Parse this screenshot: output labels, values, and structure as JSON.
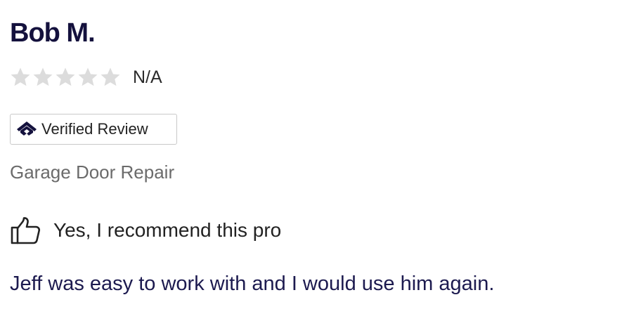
{
  "review": {
    "reviewer_name": "Bob M.",
    "rating": {
      "stars_filled": 0,
      "stars_total": 5,
      "text": "N/A",
      "star_color": "#dcdcdc"
    },
    "verified_badge": {
      "icon": "house-icon",
      "label": "Verified Review"
    },
    "service": "Garage Door Repair",
    "recommendation": {
      "icon": "thumbs-up-icon",
      "text": "Yes, I recommend this pro"
    },
    "body": "Jeff was easy to work with and I would use him again."
  },
  "colors": {
    "name": "#14113d",
    "body": "#1c1a4f",
    "service": "#6b6b6b",
    "badge_border": "#c9c9c9"
  }
}
